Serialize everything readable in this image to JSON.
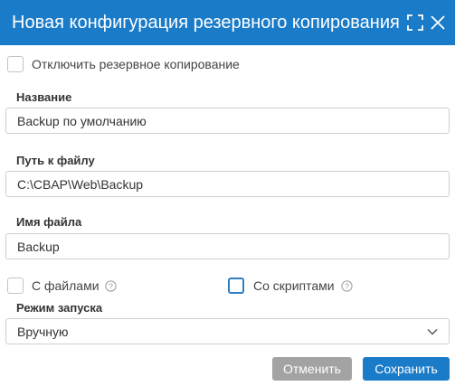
{
  "dialog": {
    "title": "Новая конфигурация резервного копирования"
  },
  "disable_backup": {
    "label": "Отключить резервное копирование",
    "checked": false
  },
  "fields": {
    "name": {
      "label": "Название",
      "value": "Backup по умолчанию"
    },
    "path": {
      "label": "Путь к файлу",
      "value": "C:\\CBAP\\Web\\Backup"
    },
    "filename": {
      "label": "Имя файла",
      "value": "Backup"
    }
  },
  "options": {
    "with_files": {
      "label": "С файлами",
      "checked": false
    },
    "with_scripts": {
      "label": "Со скриптами",
      "checked": false
    }
  },
  "launch_mode": {
    "label": "Режим запуска",
    "selected": "Вручную"
  },
  "buttons": {
    "cancel": "Отменить",
    "save": "Сохранить"
  },
  "colors": {
    "header": "#1a7bc9",
    "primary_button": "#1a7bc9",
    "secondary_button": "#a3a3a3",
    "focus_border": "#2d7fc4"
  },
  "icons": {
    "expand": "expand-icon",
    "close": "close-icon",
    "help": "help-icon",
    "chevron": "chevron-down-icon"
  }
}
